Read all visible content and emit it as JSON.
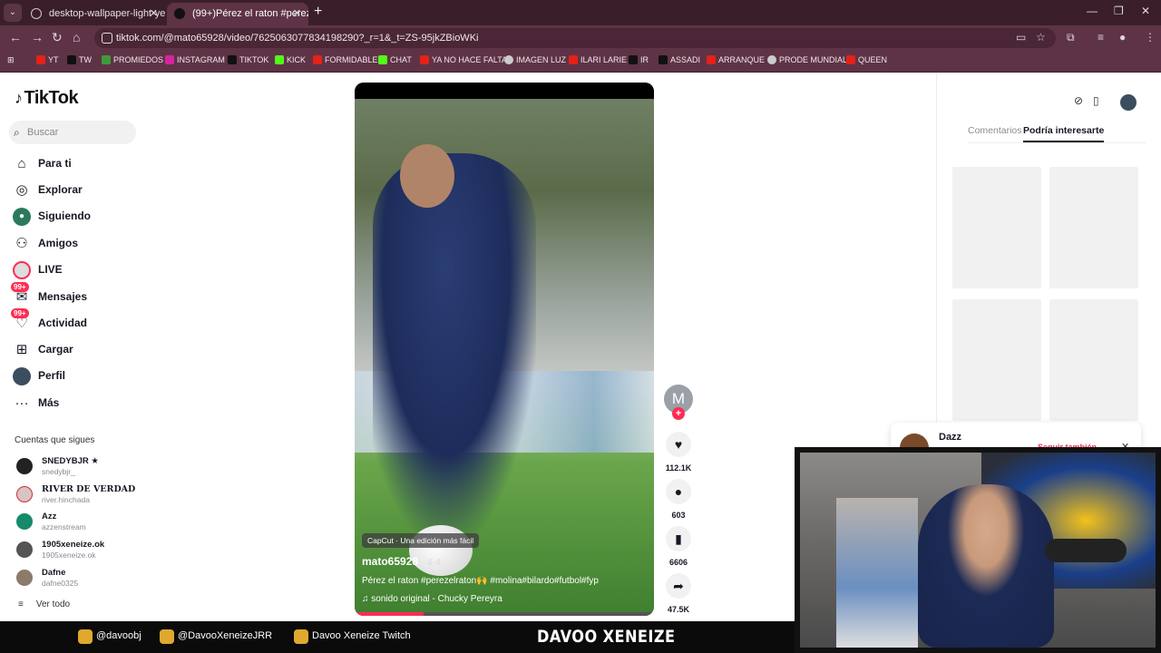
{
  "browser": {
    "tabs": [
      {
        "title": "desktop-wallpaper-light-yellow"
      },
      {
        "title": "(99+)Pérez el raton #perezel..."
      }
    ],
    "url": "tiktok.com/@mato65928/video/7625063077834198290?_r=1&_t=ZS-95jkZBioWKi",
    "bookmarks": [
      "YT",
      "TW",
      "PROMIEDOS",
      "INSTAGRAM",
      "TIKTOK",
      "KICK",
      "FORMIDABLE",
      "CHAT",
      "YA NO HACE FALTA",
      "IMAGEN LUZ",
      "ILARI LARIE",
      "IR",
      "ASSADI",
      "ARRANQUE",
      "PRODE MUNDIAL",
      "QUEEN"
    ]
  },
  "sidebar": {
    "logo": "TikTok",
    "search_placeholder": "Buscar",
    "nav": [
      {
        "label": "Para ti",
        "icon": "home-icon"
      },
      {
        "label": "Explorar",
        "icon": "compass-icon"
      },
      {
        "label": "Siguiendo",
        "icon": "following-icon"
      },
      {
        "label": "Amigos",
        "icon": "friends-icon"
      },
      {
        "label": "LIVE",
        "icon": "live-icon"
      },
      {
        "label": "Mensajes",
        "icon": "messages-icon",
        "badge": "99+"
      },
      {
        "label": "Actividad",
        "icon": "activity-icon",
        "badge": "99+"
      },
      {
        "label": "Cargar",
        "icon": "upload-icon"
      },
      {
        "label": "Perfil",
        "icon": "profile-icon"
      },
      {
        "label": "Más",
        "icon": "more-icon"
      }
    ],
    "following_title": "Cuentas que sigues",
    "following": [
      {
        "name": "SNEDYBJR ★",
        "user": "snedybjr_"
      },
      {
        "name": "RIVER DE VERDAD",
        "user": "river.hinchada"
      },
      {
        "name": "Azz",
        "user": "azzenstream"
      },
      {
        "name": "1905xeneize.ok",
        "user": "1905xeneize.ok"
      },
      {
        "name": "Dafne",
        "user": "dafne0325"
      }
    ],
    "see_all": "Ver todo"
  },
  "video": {
    "capcut": "CapCut · Una edición más fácil",
    "username": "mato65928",
    "date": "· 4-4",
    "description": "Pérez el raton #perezelraton🙌 #molina#bilardo#futbol#fyp",
    "sound": "sonido original - Chucky Pereyra",
    "progress": 0.23
  },
  "actions": {
    "author_initial": "M",
    "likes": "112.1K",
    "comments": "603",
    "saves": "6606",
    "shares": "47.5K"
  },
  "right_panel": {
    "tab_comments": "Comentarios",
    "tab_suggested": "Podría interesarte",
    "popup_name": "Dazz",
    "popup_follow": "Seguir también"
  },
  "stream": {
    "instagram": "@davoobj",
    "twitter": "@DavooXeneizeJRR",
    "youtube": "Davoo Xeneize Twitch",
    "brand": "DAVOO XENEIZE"
  }
}
